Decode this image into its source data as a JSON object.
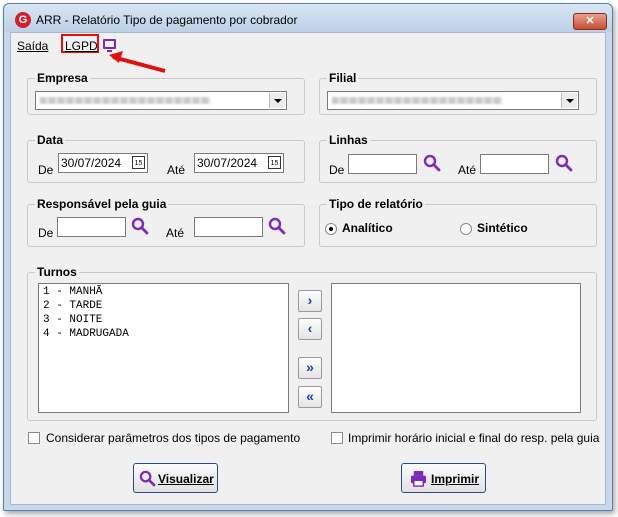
{
  "window": {
    "title": "ARR - Relatório Tipo de pagamento por cobrador",
    "close_label": "✕",
    "app_icon_letter": "G"
  },
  "menu": {
    "saida": "Saída",
    "lgpd": "LGPD"
  },
  "empresa": {
    "legend": "Empresa"
  },
  "filial": {
    "legend": "Filial"
  },
  "data": {
    "legend": "Data",
    "de_label": "De",
    "de_value": "30/07/2024",
    "ate_label": "Até",
    "ate_value": "30/07/2024",
    "cal_glyph": "15"
  },
  "linhas": {
    "legend": "Linhas",
    "de_label": "De",
    "de_value": "",
    "ate_label": "Até",
    "ate_value": ""
  },
  "responsavel": {
    "legend": "Responsável pela guia",
    "de_label": "De",
    "de_value": "",
    "ate_label": "Até",
    "ate_value": ""
  },
  "tipo_relatorio": {
    "legend": "Tipo de relatório",
    "options": [
      "Analítico",
      "Sintético"
    ],
    "selected": "Analítico"
  },
  "turnos": {
    "legend": "Turnos",
    "items": [
      "1 - MANHÃ",
      "2 - TARDE",
      "3 - NOITE",
      "4 - MADRUGADA"
    ],
    "selected_items": []
  },
  "transfer_buttons": {
    "add_one": "›",
    "remove_one": "‹",
    "add_all": "»",
    "remove_all": "«"
  },
  "checkboxes": {
    "considerar": "Considerar parâmetros dos tipos de pagamento",
    "imprimir_horario": "Imprimir horário inicial e final do resp. pela guia"
  },
  "buttons": {
    "visualizar": "Visualizar",
    "imprimir": "Imprimir"
  },
  "colors": {
    "accent": "#7b2bb8",
    "highlight": "#e01010",
    "arrow_blue": "#1a3fb8"
  }
}
